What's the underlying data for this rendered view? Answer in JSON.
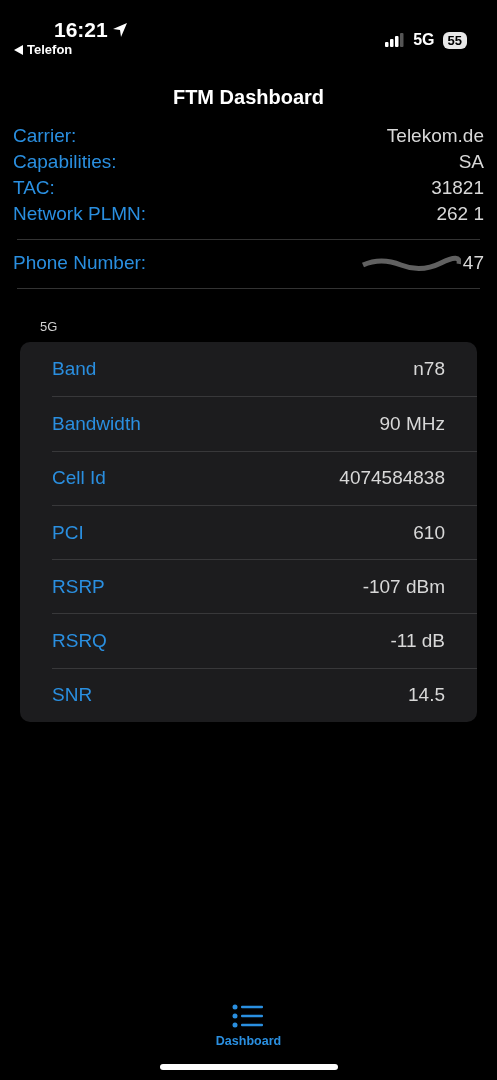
{
  "status_bar": {
    "time": "16:21",
    "back_app": "Telefon",
    "network": "5G",
    "battery": "55"
  },
  "nav": {
    "title": "FTM Dashboard"
  },
  "info": [
    {
      "label": "Carrier:",
      "value": "Telekom.de"
    },
    {
      "label": "Capabilities:",
      "value": "SA"
    },
    {
      "label": "TAC:",
      "value": "31821"
    },
    {
      "label": "Network PLMN:",
      "value": "262 1"
    }
  ],
  "phone": {
    "label": "Phone Number:",
    "value": "47",
    "redacted": true
  },
  "section": {
    "header": "5G",
    "rows": [
      {
        "label": "Band",
        "value": "n78"
      },
      {
        "label": "Bandwidth",
        "value": "90 MHz"
      },
      {
        "label": "Cell Id",
        "value": "4074584838"
      },
      {
        "label": "PCI",
        "value": "610"
      },
      {
        "label": "RSRP",
        "value": "-107 dBm"
      },
      {
        "label": "RSRQ",
        "value": "-11 dB"
      },
      {
        "label": "SNR",
        "value": "14.5"
      }
    ]
  },
  "tab_bar": [
    {
      "label": "Dashboard",
      "selected": true
    }
  ]
}
